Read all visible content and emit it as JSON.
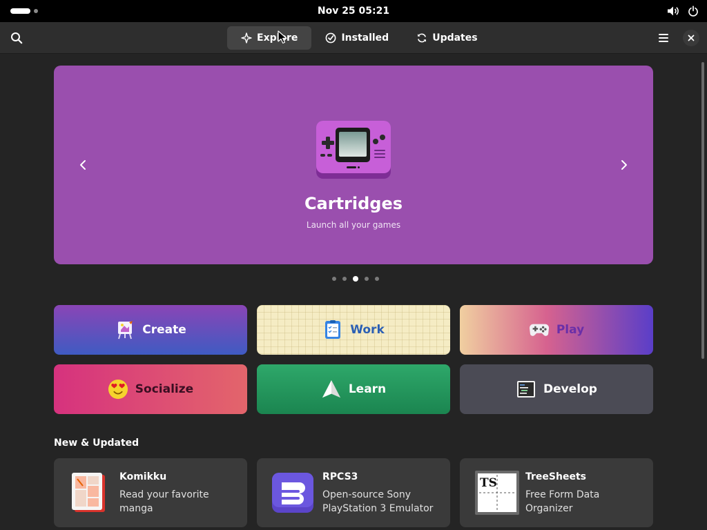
{
  "topbar": {
    "clock": "Nov 25  05:21",
    "icons": [
      "volume-icon",
      "power-icon"
    ]
  },
  "headerbar": {
    "tabs": [
      {
        "label": "Explore",
        "icon": "sparkle-icon",
        "active": true
      },
      {
        "label": "Installed",
        "icon": "check-circle-icon",
        "active": false
      },
      {
        "label": "Updates",
        "icon": "refresh-icon",
        "active": false
      }
    ],
    "icons": [
      "search-icon",
      "hamburger-menu-icon",
      "close-icon"
    ]
  },
  "hero": {
    "title": "Cartridges",
    "subtitle": "Launch all your games",
    "background": "#9a4fae",
    "page_count": 5,
    "current_page": 3
  },
  "categories": [
    {
      "label": "Create"
    },
    {
      "label": "Work"
    },
    {
      "label": "Play"
    },
    {
      "label": "Socialize"
    },
    {
      "label": "Learn"
    },
    {
      "label": "Develop"
    }
  ],
  "new_updated": {
    "title": "New & Updated",
    "apps": [
      {
        "name": "Komikku",
        "description": "Read your favorite manga"
      },
      {
        "name": "RPCS3",
        "description": "Open-source Sony PlayStation 3 Emulator"
      },
      {
        "name": "TreeSheets",
        "description": "Free Form Data Organizer",
        "icon_text": "TS"
      }
    ]
  }
}
